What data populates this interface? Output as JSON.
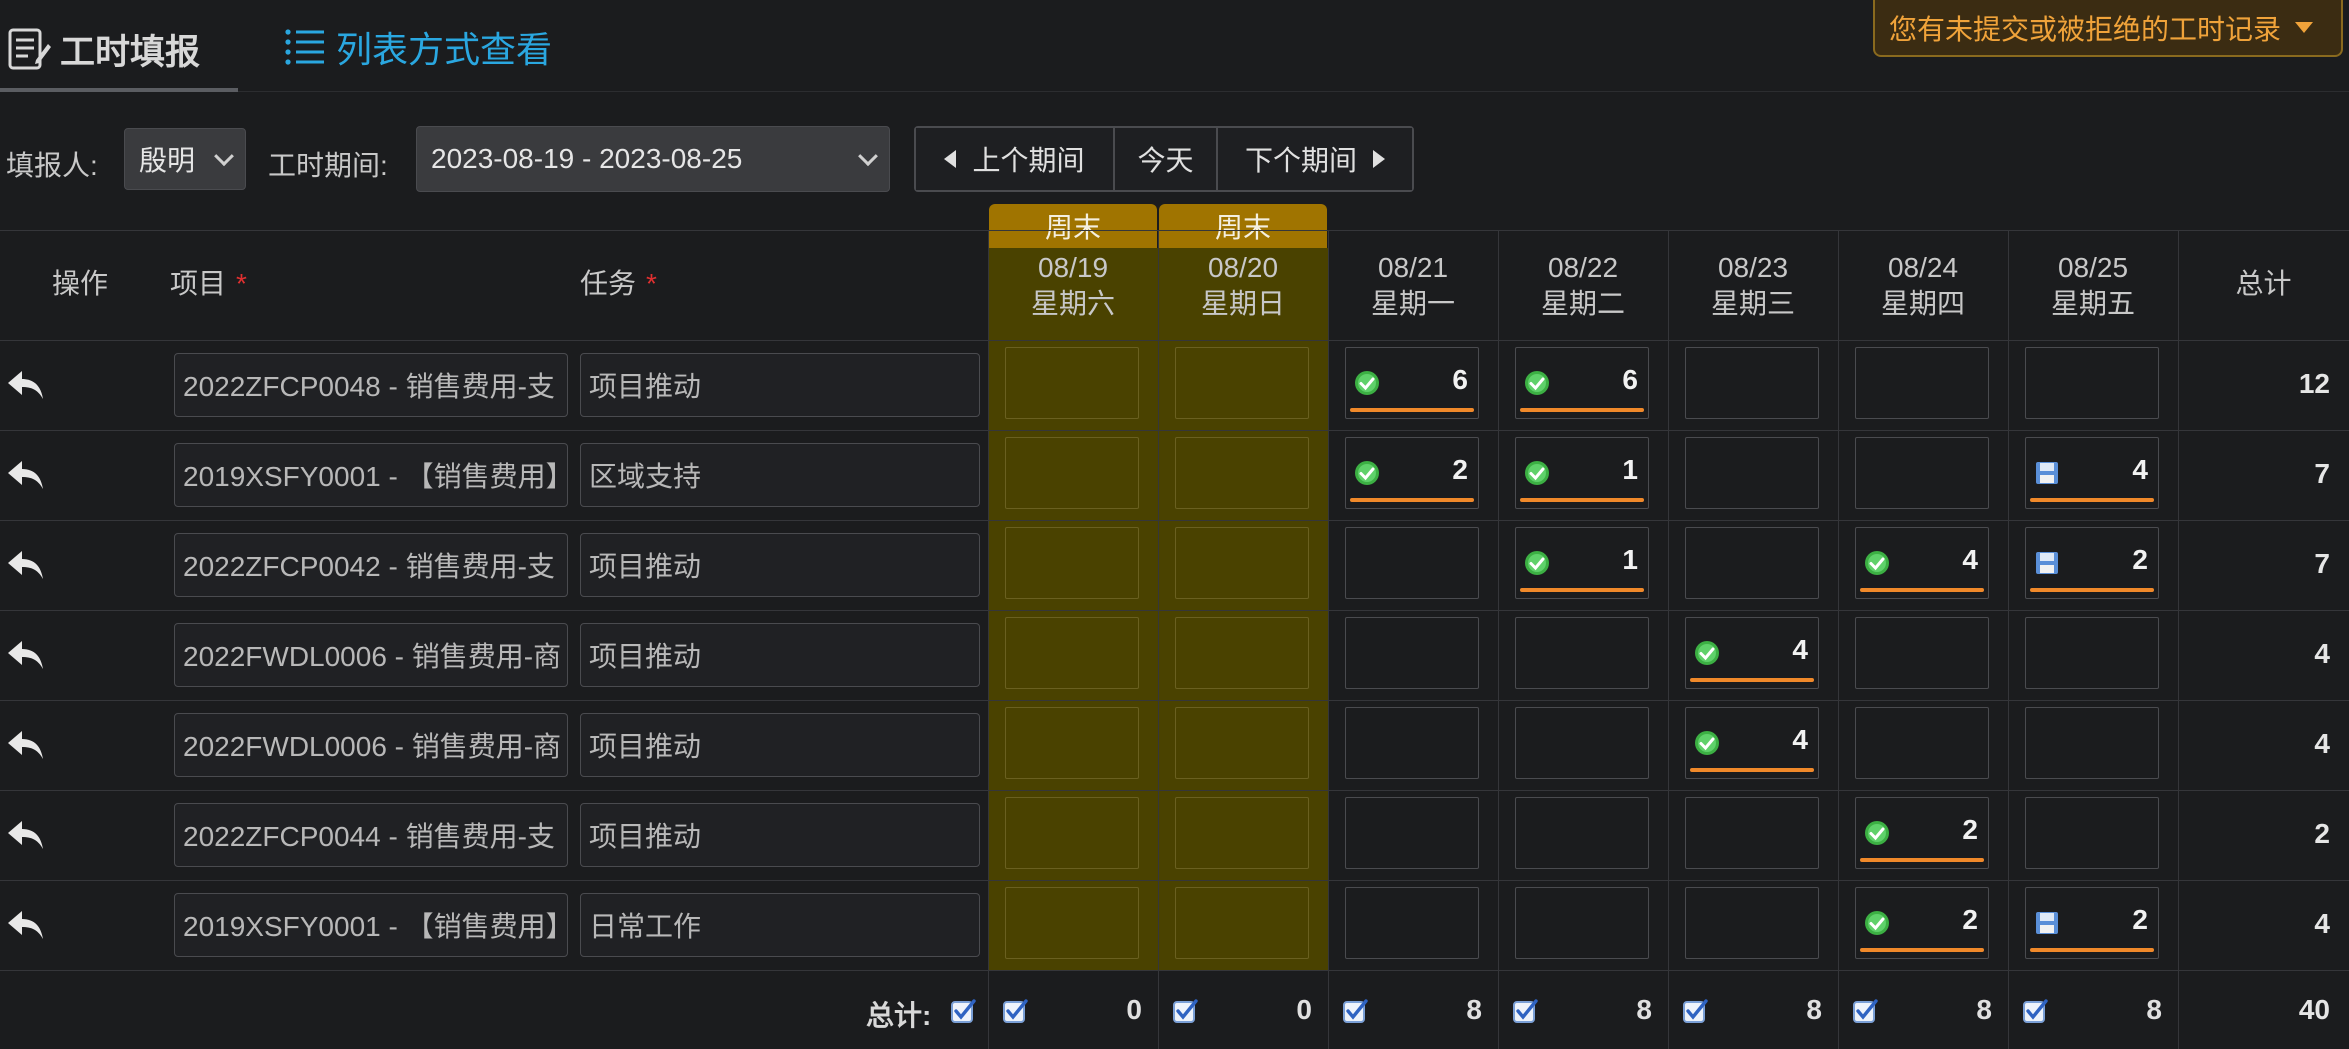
{
  "tabs": {
    "fill_label": "工时填报",
    "list_label": "列表方式查看"
  },
  "notice": {
    "text": "您有未提交或被拒绝的工时记录"
  },
  "filter": {
    "reporter_label": "填报人:",
    "reporter_value": "殷明",
    "period_label": "工时期间:",
    "period_value": "2023-08-19 - 2023-08-25",
    "prev_label": "上个期间",
    "today_label": "今天",
    "next_label": "下个期间"
  },
  "columns": {
    "action": "操作",
    "project": "项目",
    "task": "任务",
    "total": "总计",
    "weekend_badge": "周末",
    "days": [
      {
        "date": "08/19",
        "weekday": "星期六",
        "weekend": true
      },
      {
        "date": "08/20",
        "weekday": "星期日",
        "weekend": true
      },
      {
        "date": "08/21",
        "weekday": "星期一",
        "weekend": false
      },
      {
        "date": "08/22",
        "weekday": "星期二",
        "weekend": false
      },
      {
        "date": "08/23",
        "weekday": "星期三",
        "weekend": false
      },
      {
        "date": "08/24",
        "weekday": "星期四",
        "weekend": false
      },
      {
        "date": "08/25",
        "weekday": "星期五",
        "weekend": false
      }
    ]
  },
  "rows": [
    {
      "project": "2022ZFCP0048 - 销售费用-支",
      "task": "项目推动",
      "total": "12",
      "cells": [
        null,
        null,
        {
          "value": "6",
          "status": "approved"
        },
        {
          "value": "6",
          "status": "approved"
        },
        null,
        null,
        null
      ]
    },
    {
      "project": "2019XSFY0001 - 【销售费用】",
      "task": "区域支持",
      "total": "7",
      "cells": [
        null,
        null,
        {
          "value": "2",
          "status": "approved"
        },
        {
          "value": "1",
          "status": "approved"
        },
        null,
        null,
        {
          "value": "4",
          "status": "saved"
        }
      ]
    },
    {
      "project": "2022ZFCP0042 - 销售费用-支",
      "task": "项目推动",
      "total": "7",
      "cells": [
        null,
        null,
        null,
        {
          "value": "1",
          "status": "approved"
        },
        null,
        {
          "value": "4",
          "status": "approved"
        },
        {
          "value": "2",
          "status": "saved"
        }
      ]
    },
    {
      "project": "2022FWDL0006 - 销售费用-商",
      "task": "项目推动",
      "total": "4",
      "cells": [
        null,
        null,
        null,
        null,
        {
          "value": "4",
          "status": "approved"
        },
        null,
        null
      ]
    },
    {
      "project": "2022FWDL0006 - 销售费用-商",
      "task": "项目推动",
      "total": "4",
      "cells": [
        null,
        null,
        null,
        null,
        {
          "value": "4",
          "status": "approved"
        },
        null,
        null
      ]
    },
    {
      "project": "2022ZFCP0044 - 销售费用-支",
      "task": "项目推动",
      "total": "2",
      "cells": [
        null,
        null,
        null,
        null,
        null,
        {
          "value": "2",
          "status": "approved"
        },
        null
      ]
    },
    {
      "project": "2019XSFY0001 - 【销售费用】",
      "task": "日常工作",
      "total": "4",
      "cells": [
        null,
        null,
        null,
        null,
        null,
        {
          "value": "2",
          "status": "approved"
        },
        {
          "value": "2",
          "status": "saved"
        }
      ]
    }
  ],
  "footer": {
    "label": "总计:",
    "day_totals": [
      "0",
      "0",
      "8",
      "8",
      "8",
      "8",
      "8"
    ],
    "grand_total": "40"
  },
  "colors": {
    "weekend_bg": "#4a4200",
    "weekend_badge": "#a07400",
    "accent_blue": "#2aa7e0",
    "notice_orange": "#f0a33a",
    "bar_orange": "#f0892a",
    "approved_green": "#3cb043",
    "required_red": "#e03030"
  },
  "icons": {
    "fill_tab": "timesheet-edit-icon",
    "list_tab": "list-icon",
    "row_action": "reply-arrow-icon",
    "approved": "check-badge-icon",
    "saved": "save-disk-icon",
    "footer_check": "checkbox-checked-icon"
  }
}
